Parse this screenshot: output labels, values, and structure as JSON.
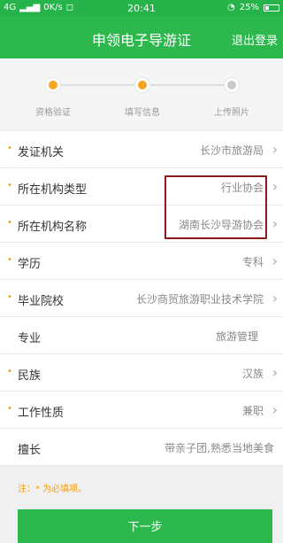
{
  "status_bar": {
    "network": "4G",
    "speed": "0K/s",
    "time": "20:41",
    "battery": "25%"
  },
  "app_bar": {
    "title": "申领电子导游证",
    "logout_label": "退出登录"
  },
  "steps": [
    {
      "label": "资格验证",
      "state": "active"
    },
    {
      "label": "填写信息",
      "state": "active"
    },
    {
      "label": "上传照片",
      "state": "inactive"
    }
  ],
  "form_rows": [
    {
      "label": "发证机关",
      "value": "长沙市旅游局",
      "required": true,
      "chevron": true
    },
    {
      "label": "所在机构类型",
      "value": "行业协会",
      "required": true,
      "chevron": true
    },
    {
      "label": "所在机构名称",
      "value": "湖南长沙导游协会",
      "required": true,
      "chevron": true
    },
    {
      "label": "学历",
      "value": "专科",
      "required": true,
      "chevron": true
    },
    {
      "label": "毕业院校",
      "value": "长沙商贸旅游职业技术学院",
      "required": true,
      "chevron": true
    },
    {
      "label": "专业",
      "value": "旅游管理",
      "required": false,
      "chevron": false
    },
    {
      "label": "民族",
      "value": "汉族",
      "required": true,
      "chevron": true
    },
    {
      "label": "工作性质",
      "value": "兼职",
      "required": true,
      "chevron": true
    },
    {
      "label": "擅长",
      "value": "带亲子团,熟悉当地美食",
      "required": false,
      "chevron": false
    }
  ],
  "required_marker": "•",
  "chevron_glyph": "›",
  "note": "注：* 为必填项。",
  "next_button_label": "下一步",
  "colors": {
    "brand_green": "#2db84d",
    "accent_orange": "#f6a623",
    "highlight_red": "#8b1a1a"
  }
}
